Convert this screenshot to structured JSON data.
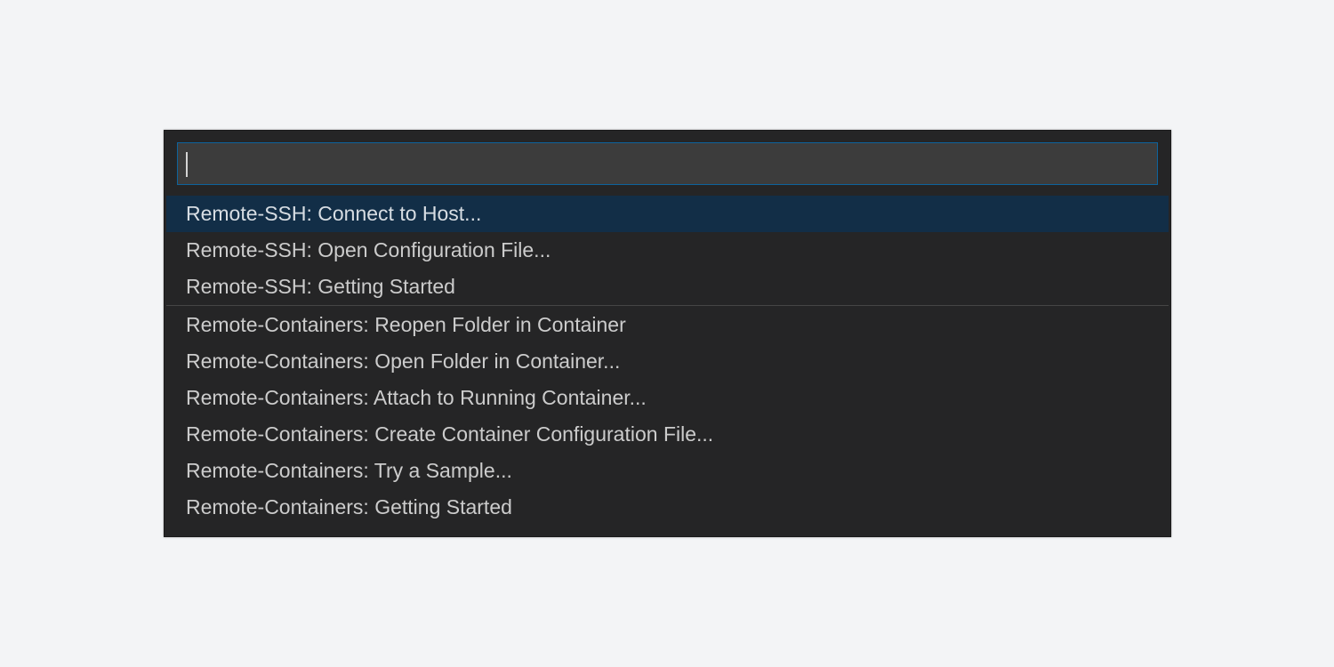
{
  "quick_pick": {
    "input": {
      "value": "",
      "placeholder": ""
    },
    "groups": [
      {
        "items": [
          {
            "label": "Remote-SSH: Connect to Host...",
            "selected": true
          },
          {
            "label": "Remote-SSH: Open Configuration File...",
            "selected": false
          },
          {
            "label": "Remote-SSH: Getting Started",
            "selected": false
          }
        ]
      },
      {
        "items": [
          {
            "label": "Remote-Containers: Reopen Folder in Container",
            "selected": false
          },
          {
            "label": "Remote-Containers: Open Folder in Container...",
            "selected": false
          },
          {
            "label": "Remote-Containers: Attach to Running Container...",
            "selected": false
          },
          {
            "label": "Remote-Containers: Create Container Configuration File...",
            "selected": false
          },
          {
            "label": "Remote-Containers: Try a Sample...",
            "selected": false
          },
          {
            "label": "Remote-Containers: Getting Started",
            "selected": false
          }
        ]
      }
    ],
    "colors": {
      "background": "#252526",
      "input_background": "#3c3c3c",
      "input_border": "#0e639c",
      "selected_background": "#122e47",
      "text": "#cccccc"
    }
  }
}
